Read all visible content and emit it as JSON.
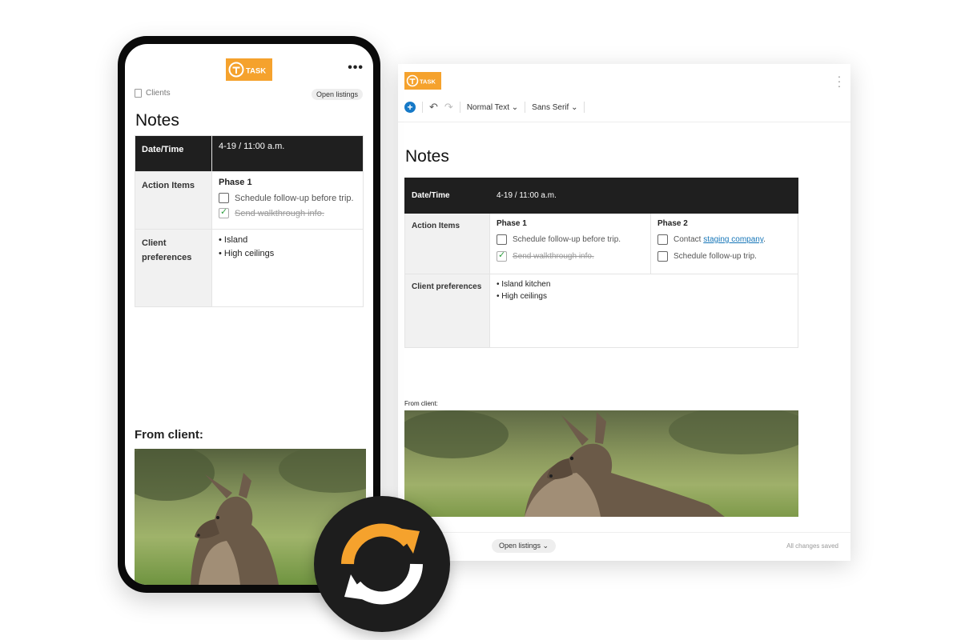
{
  "brand": {
    "logo_text": "TASK",
    "accent": "#f5a22d"
  },
  "desktop": {
    "toolbar": {
      "add_icon": "plus-circle-icon",
      "undo_icon": "undo-icon",
      "redo_icon": "redo-icon",
      "text_style": "Normal Text",
      "font": "Sans Serif"
    },
    "title": "Notes",
    "table": {
      "header_label": "Date/Time",
      "header_value": "4-19 / 11:00 a.m.",
      "action_label": "Action Items",
      "phase1_title": "Phase 1",
      "phase1_item1": "Schedule follow-up before trip.",
      "phase1_item2": "Send walkthrough info.",
      "phase2_title": "Phase 2",
      "phase2_item1_prefix": "Contact ",
      "phase2_item1_link": "staging company",
      "phase2_item1_suffix": ".",
      "phase2_item2": "Schedule follow-up trip.",
      "prefs_label": "Client preferences",
      "pref1": "• Island kitchen",
      "pref2": "• High ceilings"
    },
    "from_client": "From client:",
    "open_listings": "Open listings ⌄",
    "status": "All changes saved"
  },
  "phone": {
    "breadcrumb": "Clients",
    "open_listings": "Open listings",
    "title": "Notes",
    "table": {
      "header_label": "Date/Time",
      "header_value": "4-19 / 11:00 a.m.",
      "action_label": "Action Items",
      "phase1_title": "Phase 1",
      "phase1_item1": "Schedule follow-up before trip.",
      "phase1_item2": "Send walkthrough info.",
      "prefs_label": "Client preferences",
      "pref1": "• Island",
      "pref2": "• High ceilings"
    },
    "from_client": "From client:"
  },
  "sync_icon": "sync-arrows-icon"
}
